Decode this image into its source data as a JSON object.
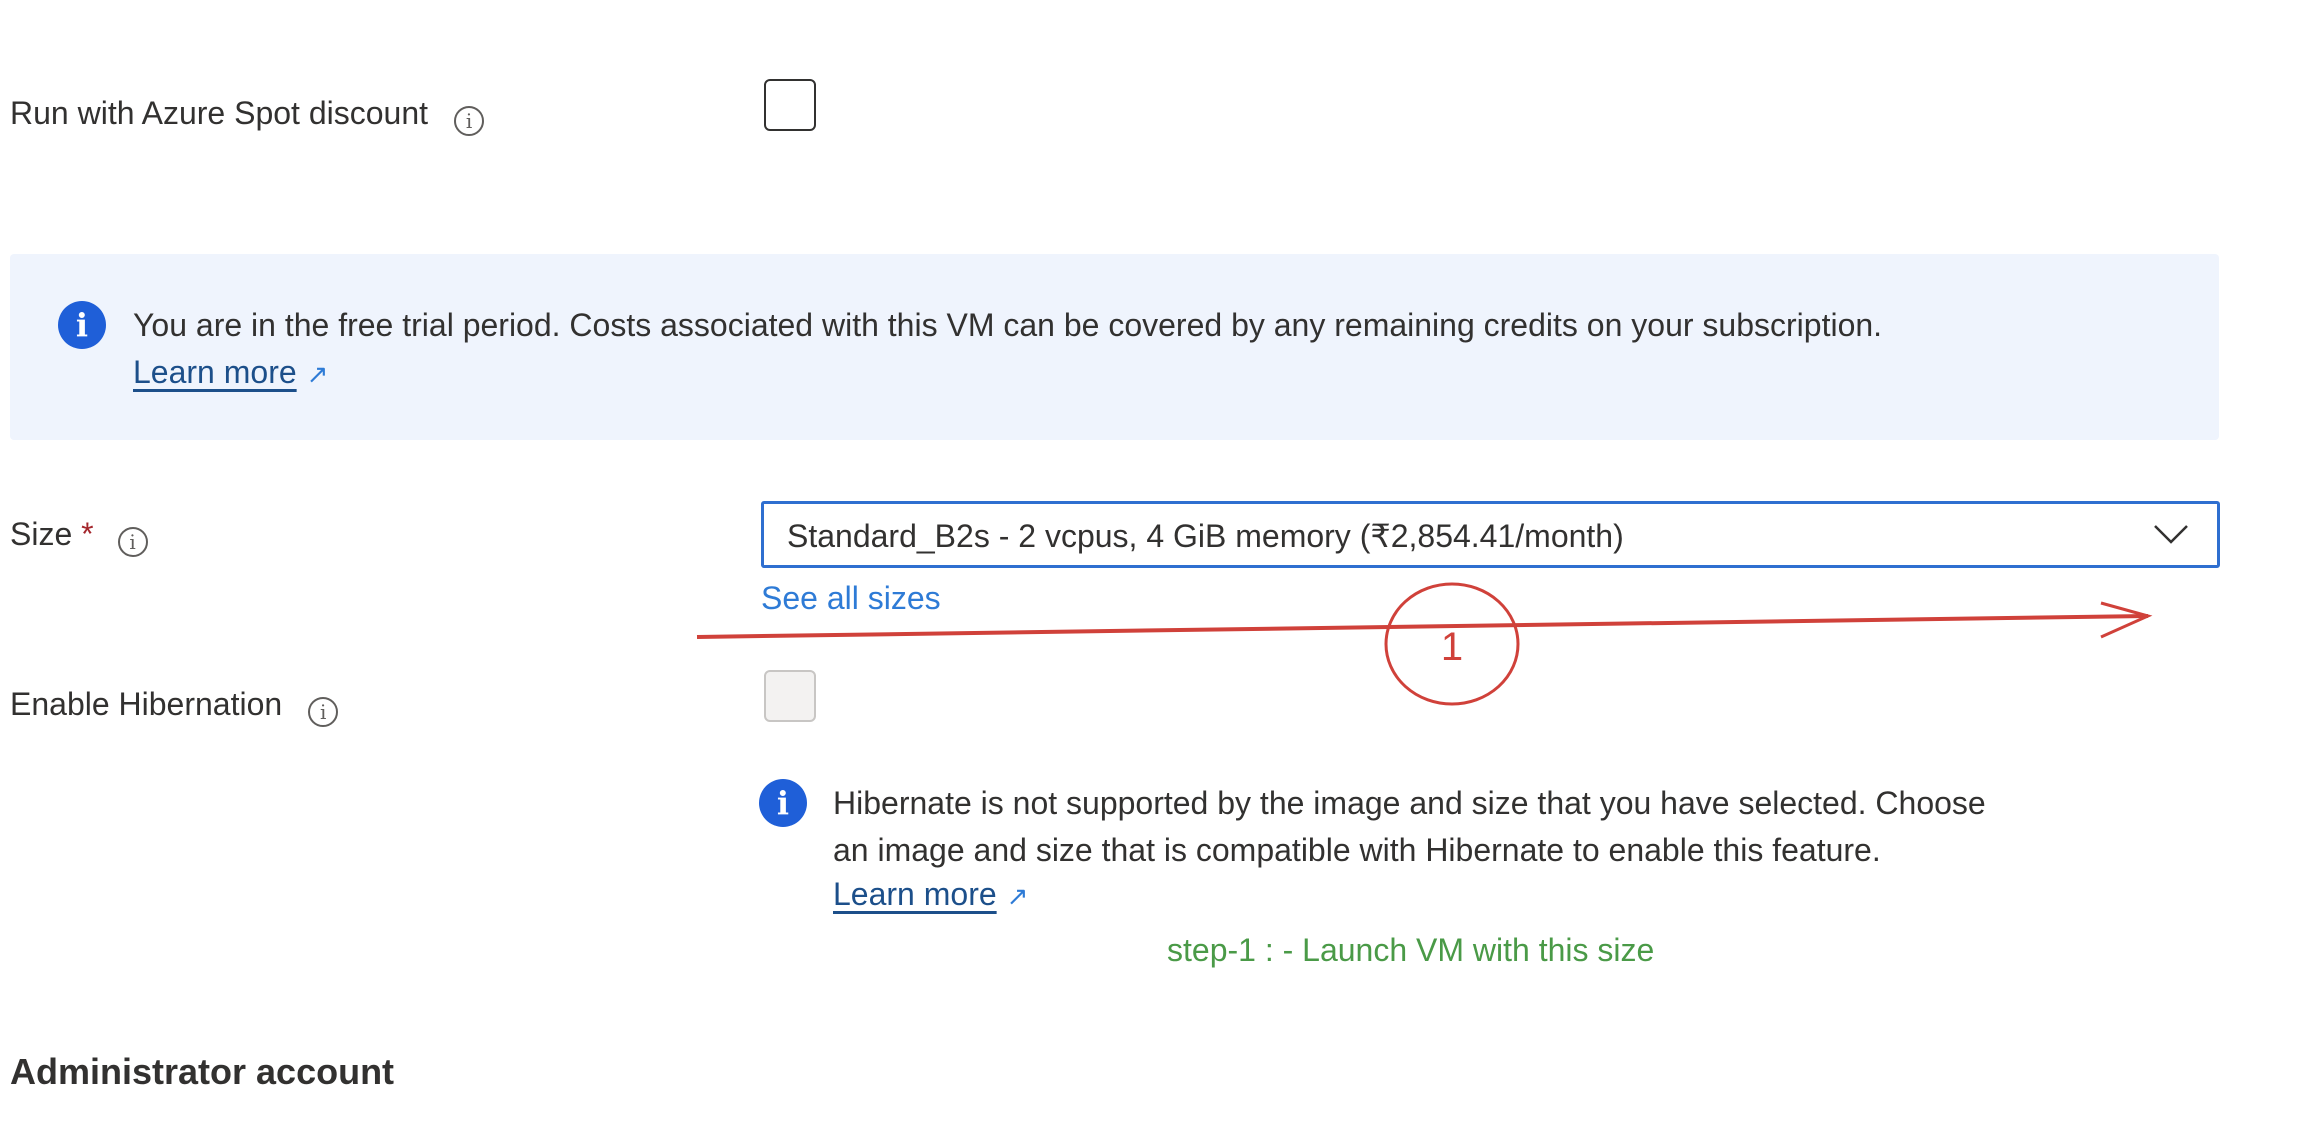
{
  "spot": {
    "label": "Run with Azure Spot discount",
    "checked": false
  },
  "trial_notice": {
    "icon": "info-icon",
    "text": "You are in the free trial period. Costs associated with this VM can be covered by any remaining credits on your subscription.",
    "link": "Learn more"
  },
  "size": {
    "label": "Size",
    "required_mark": "*",
    "value": "Standard_B2s - 2 vcpus, 4 GiB memory (₹2,854.41/month)",
    "see_all": "See all sizes"
  },
  "hibernation": {
    "label": "Enable Hibernation",
    "checked": false,
    "disabled": true,
    "notice_line1": "Hibernate is not supported by the image and size that you have selected. Choose",
    "notice_line2": "an image and size that is compatible with Hibernate to enable this feature.",
    "link": "Learn more"
  },
  "annotation": {
    "marker": "1",
    "note": "step-1 : - Launch VM with this size",
    "arrow_color": "#d0413a",
    "note_color": "#4a9a47"
  },
  "section": {
    "title": "Administrator account"
  },
  "colors": {
    "accent": "#2f6fd0",
    "link": "#2e7bd6",
    "notice_bg": "#eff4fd",
    "required": "#a4262c"
  }
}
